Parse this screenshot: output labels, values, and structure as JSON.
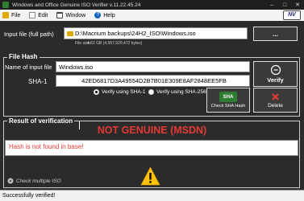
{
  "window": {
    "title": "Windows and Office Genuine ISO Verifier v.11.22.45.24",
    "logo": "NV"
  },
  "menu": {
    "file": "File",
    "edit": "Edit",
    "window": "Window",
    "help": "Help"
  },
  "input_file": {
    "label": "Input file (full path)",
    "value": "D:\\Macrium backups\\24H2_ISO\\Windows.iso",
    "browse_label": "...",
    "size_prefix": "File size:",
    "size_value": "4.62 GB  (4,957,929,472 bytes)"
  },
  "file_hash": {
    "legend": "File Hash",
    "name_label": "Name of input file",
    "name_value": "Windows.iso",
    "sha_label": "SHA-1",
    "sha_value": "42ED6817D3A49554D2B7B01E309E8AF2848EE5FB",
    "verify_sha1": "Verify using SHA-1",
    "verify_sha256": "Verify using SHA-256",
    "verify_button": "Verify",
    "check_sha_icon_text": "SHA",
    "check_sha_button": "Check SHA Hash",
    "delete_button": "Delete"
  },
  "result": {
    "legend": "Result of verification",
    "status": "NOT GENUINE (MSDN)",
    "message": "Hash is not found in base!",
    "check_multiple": "Check multiple ISO"
  },
  "status_bar": {
    "text": "Successfully verified!"
  },
  "colors": {
    "not_genuine": "#e53935",
    "warning": "#ffc107",
    "background": "#2b2b2b"
  }
}
